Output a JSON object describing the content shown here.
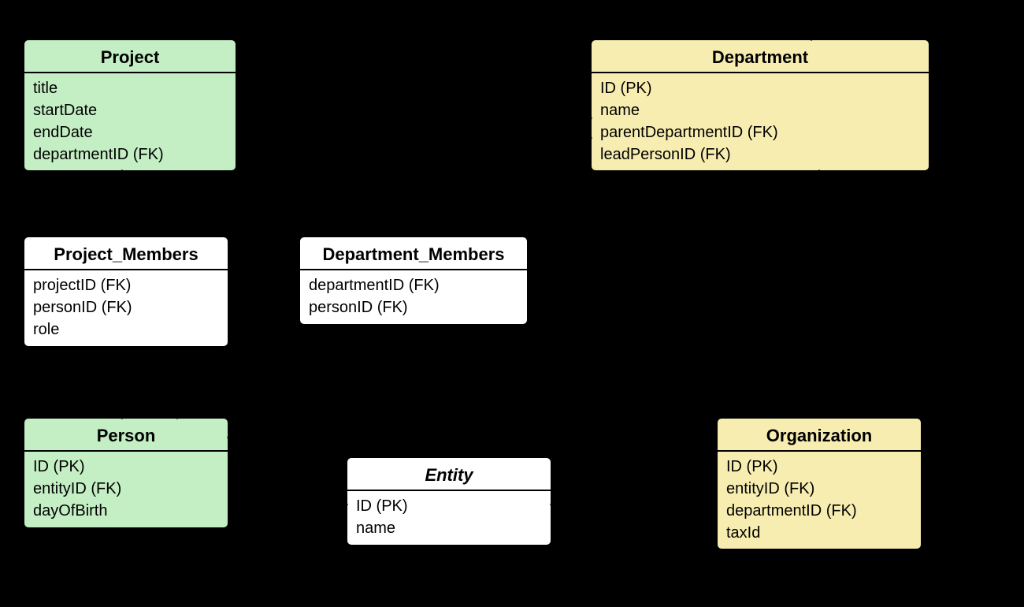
{
  "entities": {
    "project": {
      "title": "Project",
      "attrs": [
        "title",
        "startDate",
        "endDate",
        "departmentID (FK)"
      ]
    },
    "department": {
      "title": "Department",
      "attrs": [
        "ID (PK)",
        "name",
        "parentDepartmentID (FK)",
        "leadPersonID (FK)"
      ]
    },
    "project_members": {
      "title": "Project_Members",
      "attrs": [
        "projectID (FK)",
        "personID (FK)",
        "role"
      ]
    },
    "department_members": {
      "title": "Department_Members",
      "attrs": [
        "departmentID (FK)",
        "personID (FK)"
      ]
    },
    "person": {
      "title": "Person",
      "attrs": [
        "ID (PK)",
        "entityID (FK)",
        "dayOfBirth"
      ]
    },
    "entity": {
      "title": "Entity",
      "attrs": [
        "ID (PK)",
        "name"
      ]
    },
    "organization": {
      "title": "Organization",
      "attrs": [
        "ID (PK)",
        "entityID (FK)",
        "departmentID (FK)",
        "taxId"
      ]
    }
  }
}
